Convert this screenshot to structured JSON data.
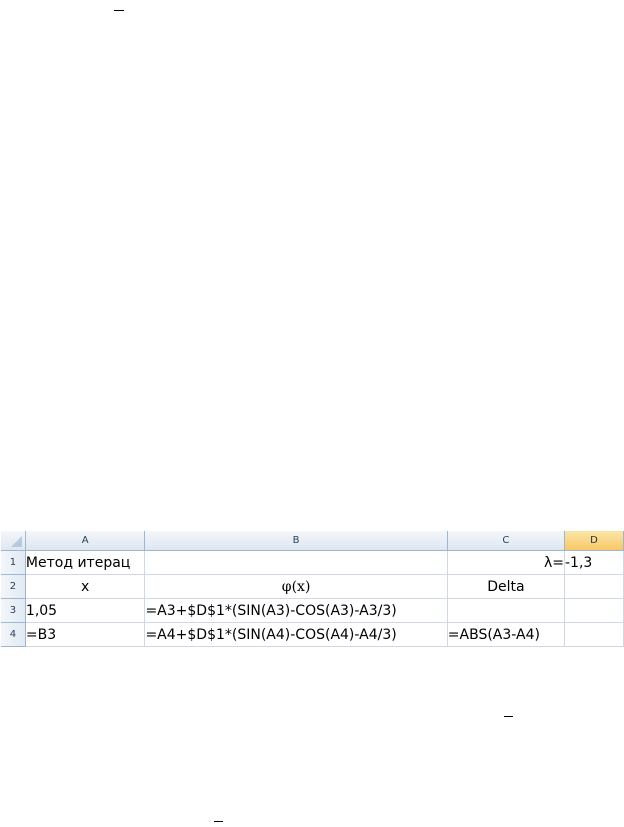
{
  "columns": [
    "A",
    "B",
    "C",
    "D"
  ],
  "rows": [
    {
      "num": "1",
      "A": "Метод итерац",
      "B": "",
      "C": "λ=",
      "D": "-1,3"
    },
    {
      "num": "2",
      "A": "x",
      "B": "φ(x)",
      "C": "Delta",
      "D": ""
    },
    {
      "num": "3",
      "A": "1,05",
      "B": "=A3+$D$1*(SIN(A3)-COS(A3)-A3/3)",
      "C": "",
      "D": ""
    },
    {
      "num": "4",
      "A": "=B3",
      "B": "=A4+$D$1*(SIN(A4)-COS(A4)-A4/3)",
      "C": "=ABS(A3-A4)",
      "D": ""
    }
  ],
  "active_column": "D",
  "colors": {
    "header_bg": "#dde6f1",
    "header_active": "#f7c865",
    "grid": "#d0d7e5",
    "header_border": "#9eb6ce"
  }
}
